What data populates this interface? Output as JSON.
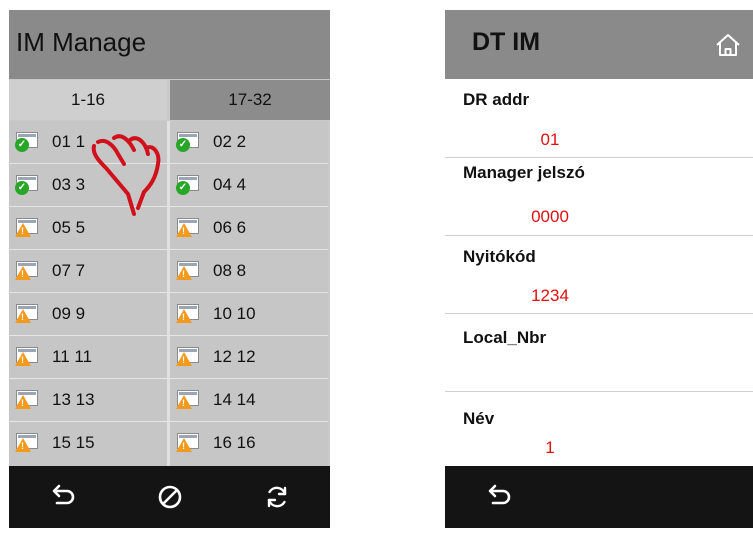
{
  "left": {
    "title": "IM Manage",
    "tabs": [
      {
        "label": "1-16",
        "selected": true
      },
      {
        "label": "17-32",
        "selected": false
      }
    ],
    "cells": [
      {
        "label": "01 1",
        "status": "ok"
      },
      {
        "label": "02 2",
        "status": "ok"
      },
      {
        "label": "03 3",
        "status": "ok"
      },
      {
        "label": "04 4",
        "status": "ok"
      },
      {
        "label": "05 5",
        "status": "warn"
      },
      {
        "label": "06 6",
        "status": "warn"
      },
      {
        "label": "07 7",
        "status": "warn"
      },
      {
        "label": "08 8",
        "status": "warn"
      },
      {
        "label": "09 9",
        "status": "warn"
      },
      {
        "label": "10 10",
        "status": "warn"
      },
      {
        "label": "11 11",
        "status": "warn"
      },
      {
        "label": "12 12",
        "status": "warn"
      },
      {
        "label": "13 13",
        "status": "warn"
      },
      {
        "label": "14 14",
        "status": "warn"
      },
      {
        "label": "15 15",
        "status": "warn"
      },
      {
        "label": "16 16",
        "status": "warn"
      }
    ],
    "footer_icons": [
      "back-icon",
      "disable-icon",
      "refresh-icon"
    ]
  },
  "right": {
    "title": "DT IM",
    "fields": [
      {
        "label": "DR addr",
        "value": "01"
      },
      {
        "label": "Manager jelszó",
        "value": "0000"
      },
      {
        "label": "Nyitókód",
        "value": "1234"
      },
      {
        "label": "Local_Nbr",
        "value": ""
      },
      {
        "label": "Név",
        "value": "1"
      }
    ],
    "footer_icons": [
      "back-icon"
    ]
  },
  "colors": {
    "header": "#8a8a8a",
    "footer": "#141414",
    "value_red": "#e01010",
    "ok_green": "#27a627",
    "warn_orange": "#f39a1c",
    "hand_red": "#d0101a"
  }
}
